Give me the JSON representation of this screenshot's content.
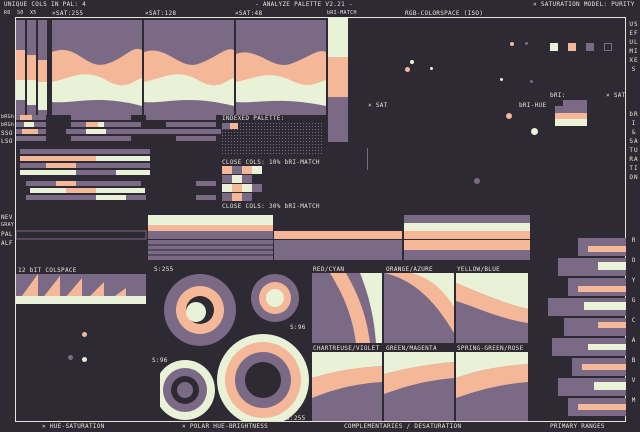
{
  "palette": {
    "dark": "#2d2a33",
    "purple": "#7a6a86",
    "peach": "#f4b899",
    "cream": "#e9f1d6"
  },
  "top": {
    "unique_cols": "UNIQUE COLS IN PAL: 4",
    "title": "- ANALYZE PALETTE V2.21 -",
    "saturation_model": "× SATURATION MODEL: PURITY",
    "sub_labels": [
      "R0",
      "S0",
      "X5"
    ],
    "xsat1": "×SAT:255",
    "xsat2": "×SAT:128",
    "xsat3": "×SAT:48",
    "bri_match_top": "bRI-MATCH",
    "rgb_colorspace": "RGB-COLORSPACE (ISO)"
  },
  "sat_labels": {
    "x_sat": "× SAT",
    "bri_hue": "bRI-HUE",
    "bri": "bRI:",
    "x_sat_right": "× SAT"
  },
  "left_labels": [
    "bRGh",
    "bRGh",
    "SSO",
    "LSO"
  ],
  "indexed": {
    "indexed_palette": "INDEXED PALETTE:",
    "close_cols_10": "CLOSE COLS: 10% bRI-MATCH",
    "close_cols_30": "CLOSE COLS: 30% bRI-MATCH"
  },
  "row_labels": [
    "NEV",
    "GRAY",
    "PAL",
    "ALF"
  ],
  "colspace": {
    "label": "12 bIT COLSPACE",
    "s255_a": "S:255",
    "s96_a": "S:96",
    "s96_b": "S:96",
    "s255_b": "S:255"
  },
  "complementaries": [
    "RED/CYAN",
    "ORANGE/AZURE",
    "YELLOW/BLUE",
    "CHARTREUSE/VIOLET",
    "GREEN/MAGENTA",
    "SPRING-GREEN/ROSE"
  ],
  "right_side": {
    "useful_mixes": "USEFUL MIXES",
    "bri_saturation": "bRI & SATURATION",
    "hue_letters": [
      "R",
      "O",
      "Y",
      "G",
      "C",
      "A",
      "B",
      "V",
      "M"
    ]
  },
  "bottom": {
    "hue_saturation": "× HUE-SATURATION",
    "polar": "× POLAR HUE-BRIGHTNESS",
    "complementaries": "COMPLEMENTARIES / DESATURATION",
    "primary_ranges": "PRIMARY RANGES"
  }
}
